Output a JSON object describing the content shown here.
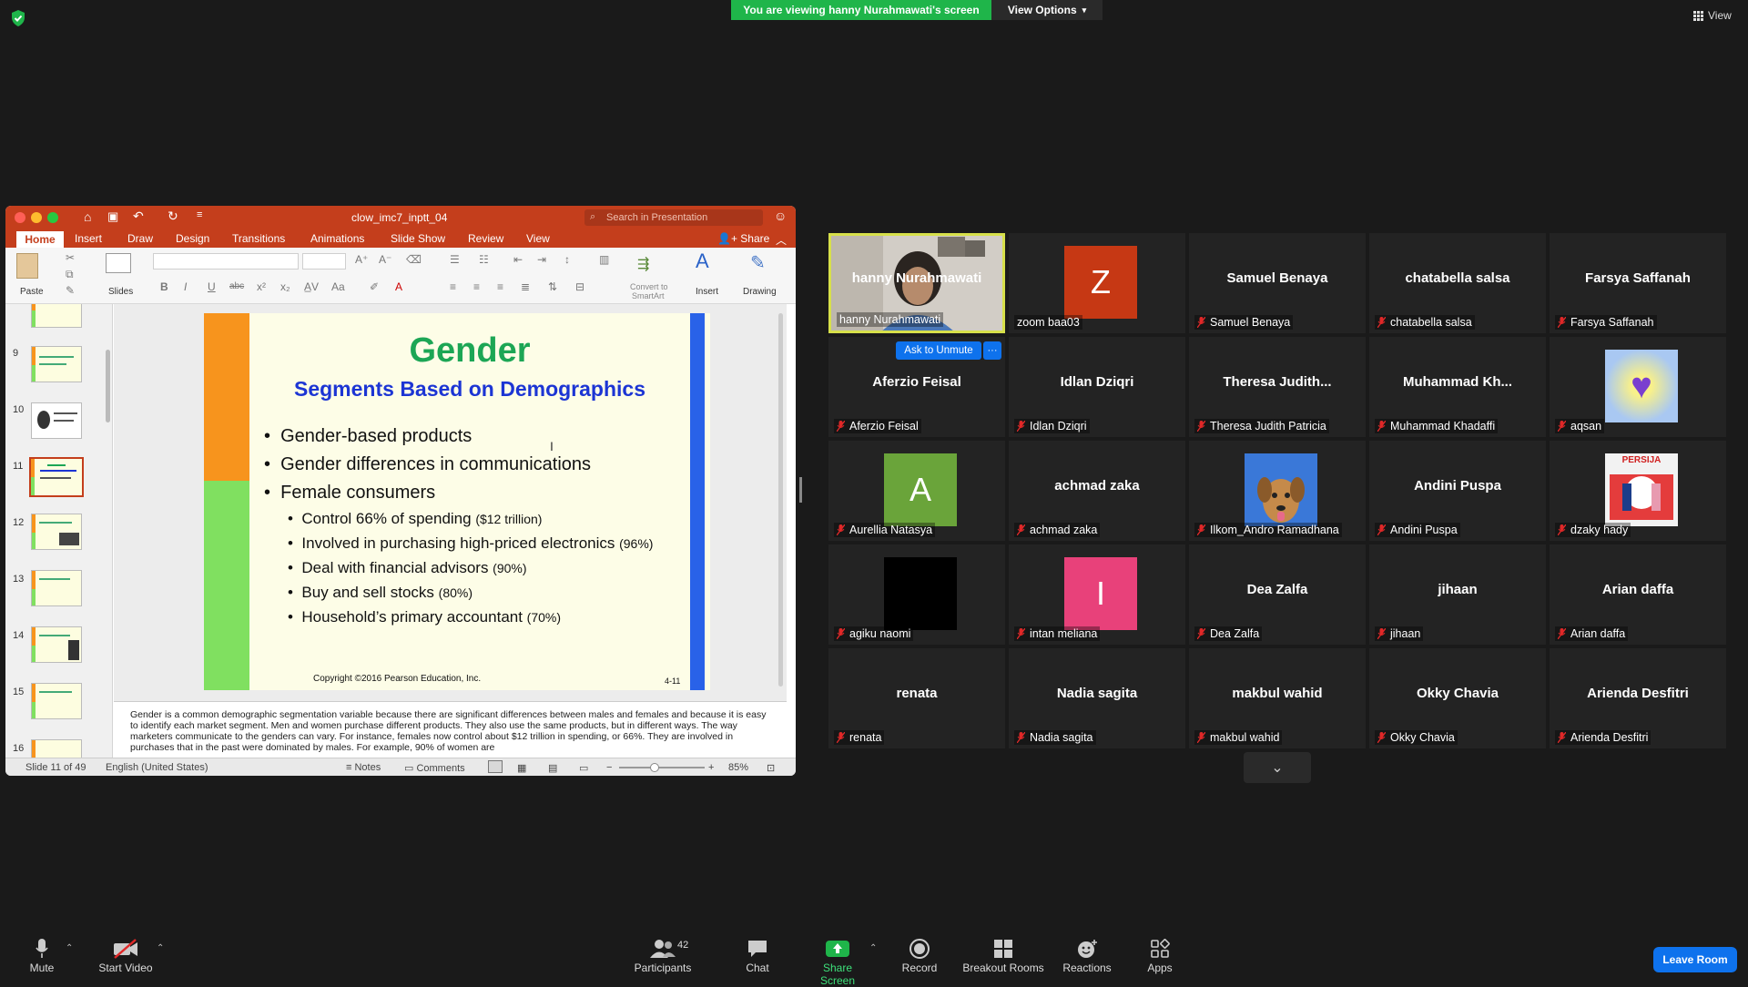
{
  "banner": {
    "viewing": "You are viewing hanny Nurahmawati's screen",
    "view_options": "View Options",
    "view": "View"
  },
  "ppt": {
    "filename": "clow_imc7_inptt_04",
    "search_placeholder": "Search in Presentation",
    "share": "Share",
    "tabs": [
      "Home",
      "Insert",
      "Draw",
      "Design",
      "Transitions",
      "Animations",
      "Slide Show",
      "Review",
      "View"
    ],
    "ribbon": {
      "paste": "Paste",
      "slides": "Slides",
      "convert": "Convert to",
      "smartart": "SmartArt",
      "insert": "Insert",
      "drawing": "Drawing"
    },
    "thumb_numbers": [
      "9",
      "10",
      "11",
      "12",
      "13",
      "14",
      "15",
      "16"
    ],
    "slide": {
      "title": "Gender",
      "subtitle": "Segments Based on Demographics",
      "bullets": [
        "Gender-based products",
        "Gender differences in communications",
        "Female consumers"
      ],
      "sub_bullets": [
        {
          "text": "Control 66% of spending ",
          "note": "($12 trillion)"
        },
        {
          "text": "Involved in purchasing high-priced electronics ",
          "note": "(96%)"
        },
        {
          "text": "Deal with financial advisors ",
          "note": "(90%)"
        },
        {
          "text": "Buy and sell stocks ",
          "note": "(80%)"
        },
        {
          "text": "Household’s primary accountant ",
          "note": "(70%)"
        }
      ],
      "copyright": "Copyright ©2016 Pearson Education, Inc.",
      "slide_code": "4-11"
    },
    "notes": "Gender is a common demographic segmentation variable because there are significant differences between males and females and because it is easy to identify each market segment. Men and women purchase different products. They also use the same products, but in different ways. The way marketers communicate to the genders can vary. For instance, females now control about $12 trillion in spending, or 66%. They are involved in purchases that in the past were dominated by males. For example, 90% of women are",
    "status": {
      "slide": "Slide 11 of 49",
      "language": "English (United States)",
      "notes": "Notes",
      "comments": "Comments",
      "zoom": "85%"
    }
  },
  "gallery": {
    "ask_to_unmute": "Ask to Unmute",
    "more": "···",
    "tiles": [
      {
        "name": "hanny Nurahmawati",
        "label": "hanny Nurahmawati",
        "kind": "video",
        "muted": false
      },
      {
        "name": "",
        "label": "zoom baa03",
        "kind": "avatar",
        "letter": "Z",
        "color": "#c63814",
        "muted": false
      },
      {
        "name": "Samuel Benaya",
        "label": "Samuel Benaya",
        "kind": "text",
        "muted": true
      },
      {
        "name": "chatabella salsa",
        "label": "chatabella salsa",
        "kind": "text",
        "muted": true
      },
      {
        "name": "Farsya Saffanah",
        "label": "Farsya Saffanah",
        "kind": "text",
        "muted": true
      },
      {
        "name": "Aferzio Feisal",
        "label": "Aferzio Feisal",
        "kind": "text",
        "muted": true
      },
      {
        "name": "Idlan Dziqri",
        "label": "Idlan Dziqri",
        "kind": "text",
        "muted": true
      },
      {
        "name": "Theresa  Judith...",
        "label": "Theresa Judith Patricia",
        "kind": "text",
        "muted": true
      },
      {
        "name": "Muhammad  Kh...",
        "label": "Muhammad Khadaffi",
        "kind": "text",
        "muted": true
      },
      {
        "name": "",
        "label": "aqsan",
        "kind": "heart",
        "muted": true
      },
      {
        "name": "",
        "label": "Aurellia Natasya",
        "kind": "avatar",
        "letter": "A",
        "color": "#6aa43a",
        "muted": true
      },
      {
        "name": "achmad zaka",
        "label": "achmad zaka",
        "kind": "text",
        "muted": true
      },
      {
        "name": "",
        "label": "Ilkom_Andro Ramadhana",
        "kind": "dog",
        "muted": true
      },
      {
        "name": "Andini Puspa",
        "label": "Andini Puspa",
        "kind": "text",
        "muted": true
      },
      {
        "name": "",
        "label": "dzaky hady",
        "kind": "persija",
        "persija": "PERSIJA",
        "muted": true
      },
      {
        "name": "",
        "label": "agiku naomi",
        "kind": "black",
        "muted": true
      },
      {
        "name": "",
        "label": "intan meliana",
        "kind": "avatar",
        "letter": "I",
        "color": "#e8417a",
        "muted": true
      },
      {
        "name": "Dea Zalfa",
        "label": "Dea Zalfa",
        "kind": "text",
        "muted": true
      },
      {
        "name": "jihaan",
        "label": "jihaan",
        "kind": "text",
        "muted": true
      },
      {
        "name": "Arian daffa",
        "label": "Arian daffa",
        "kind": "text",
        "muted": true
      },
      {
        "name": "renata",
        "label": "renata",
        "kind": "text",
        "muted": true
      },
      {
        "name": "Nadia sagita",
        "label": "Nadia sagita",
        "kind": "text",
        "muted": true
      },
      {
        "name": "makbul wahid",
        "label": "makbul wahid",
        "kind": "text",
        "muted": true
      },
      {
        "name": "Okky Chavia",
        "label": "Okky Chavia",
        "kind": "text",
        "muted": true
      },
      {
        "name": "Arienda Desfitri",
        "label": "Arienda Desfitri",
        "kind": "text",
        "muted": true
      }
    ]
  },
  "toolbar": {
    "mute": "Mute",
    "start_video": "Start Video",
    "participants": "Participants",
    "participants_count": "42",
    "chat": "Chat",
    "share_screen": "Share Screen",
    "record": "Record",
    "breakout": "Breakout Rooms",
    "reactions": "Reactions",
    "apps": "Apps",
    "leave": "Leave Room"
  },
  "colors": {
    "accent": "#0e72ed",
    "share_green": "#1fb54a",
    "ppt_red": "#c43e1c",
    "speaker_border": "#d7e04a",
    "muted_red": "#e02828"
  }
}
